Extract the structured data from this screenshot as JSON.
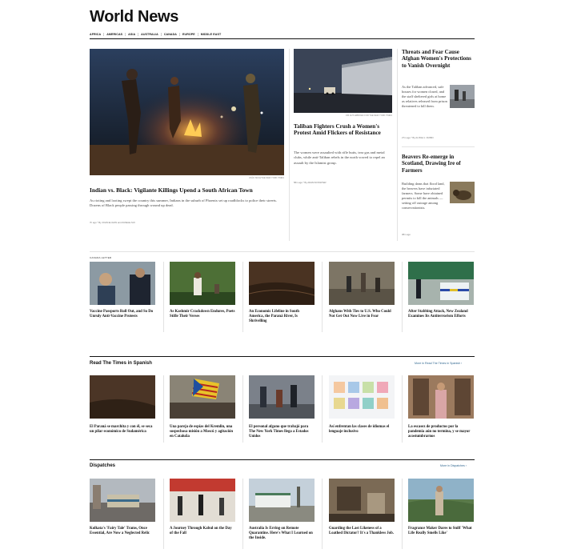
{
  "page": {
    "title": "World News"
  },
  "subnav": [
    "AFRICA",
    "AMERICAS",
    "ASIA",
    "AUSTRALIA",
    "CANADA",
    "EUROPE",
    "MIDDLE EAST"
  ],
  "lead": {
    "credit": "JOÃO SILVA/THE NEW YORK TIMES",
    "headline": "Indian vs. Black: Vigilante Killings Upend a South African Town",
    "summary": "As rioting and looting swept the country this summer, Indians in the suburb of Phoenix set up roadblocks to police their streets. Dozens of Black people passing through wound up dead.",
    "meta": "7h ago  *  By JOHN ELIGON and ZANELE MJI"
  },
  "middle": {
    "credit": "JIM HUYLEBROEK FOR THE NEW YORK TIMES",
    "headline": "Taliban Fighters Crush a Women's Protest Amid Flickers of Resistance",
    "summary": "The women were assaulted with rifle butts, tear gas and metal clubs, while anti-Taliban rebels in the north vowed to repel an assault by the Islamist group.",
    "meta": "58m ago  *  By ADAM NOSSITER"
  },
  "right": [
    {
      "headline": "Threats and Fear Cause Afghan Women's Protections to Vanish Overnight",
      "summary": "As the Taliban advanced, safe houses for women closed, and the staff sheltered girls at home as relatives released from prison threatened to kill them.",
      "meta": "27m ago  *  By ALISSA J. RUBIN"
    },
    {
      "headline": "Beavers Re-emerge in Scotland, Drawing Ire of Farmers",
      "summary": "Building dams that flood land, the beavers have infuriated farmers. Some have obtained permits to kill the animals — setting off outrage among conservationists.",
      "meta": "38m ago"
    }
  ],
  "row1": {
    "label": "CANADA LETTER",
    "items": [
      "Vaccine Passports Roll Out, and So Do Unruly Anti-Vaccine Protests",
      "As Kashmir Crackdown Endures, Poets Stifle Their Verses",
      "An Economic Lifeline in South America, the Paraná River, Is Shrivelling",
      "Afghans With Ties to U.S. Who Could Not Get Out Now Live in Fear",
      "After Stabbing Attack, New Zealand Examines Its Antiterrorism Efforts"
    ]
  },
  "spanish": {
    "title": "Read The Times in Spanish",
    "more": "More in Read The Times in Spanish ›",
    "items": [
      "El Paraná se marchita y con él, se seca un pilar económico de Sudamérica",
      "Una pareja de espías del Kremlin, una sospechosa misión a Moscú y agitación en Cataluña",
      "El personal afgano que trabajó para The New York Times llega a Estados Unidos",
      "Así enfrentan las clases de idiomas el lenguaje inclusivo",
      "La escasez de productos por la pandemia aún no termina, y se mayor acostumbrarnos"
    ]
  },
  "dispatches": {
    "title": "Dispatches",
    "more": "More in Dispatches ›",
    "items": [
      "Kolkata's 'Fairy Tale' Trams, Once Essential, Are Now a Neglected Relic",
      "A Journey Through Kabul on the Day of the Fall",
      "Australia Is Erring on Remote Quarantine. Here's What I Learned on the Inside.",
      "Guarding the Last Likeness of a Loathed Dictator? It's a Thankless Job.",
      "Fragrance Maker Dares to Sniff 'What Life Really Smells Like'"
    ]
  },
  "colors": {
    "link": "#326891",
    "rule": "#121212",
    "divider": "#e2e2e2"
  }
}
